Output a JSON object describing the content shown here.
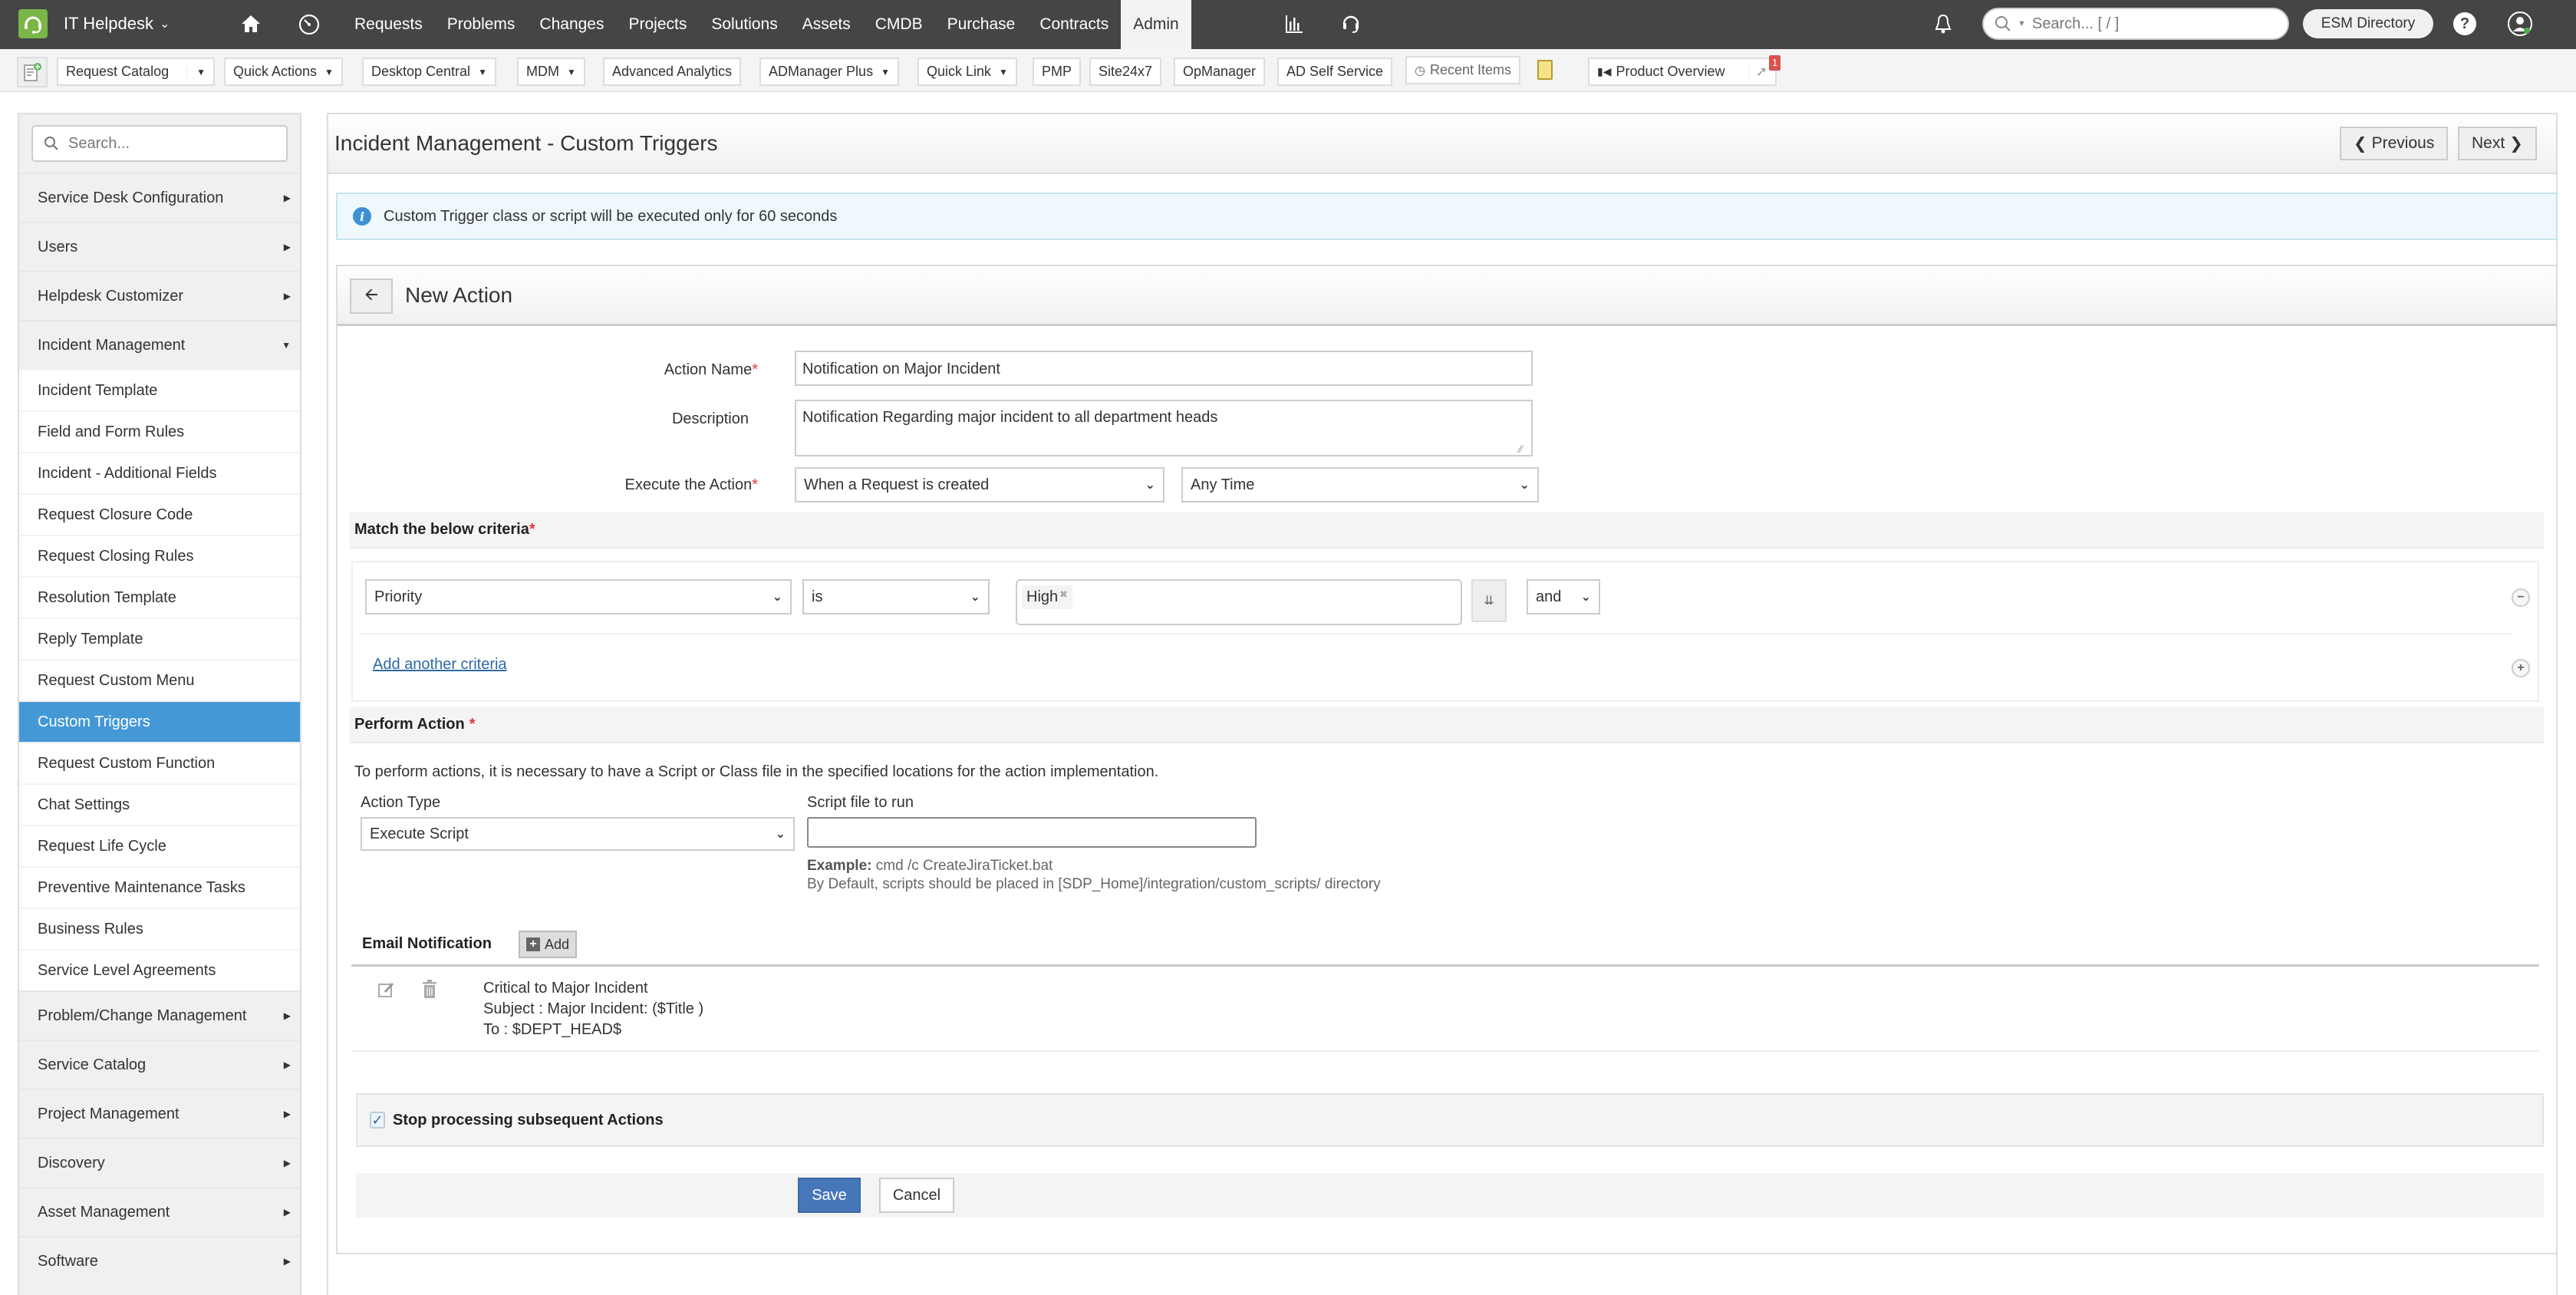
{
  "topnav": {
    "app_name": "IT Helpdesk",
    "links": [
      "Requests",
      "Problems",
      "Changes",
      "Projects",
      "Solutions",
      "Assets",
      "CMDB",
      "Purchase",
      "Contracts",
      "Admin"
    ],
    "active_link": "Admin",
    "search_placeholder": "Search... [ / ]",
    "esm_directory_label": "ESM Directory",
    "help_label": "?"
  },
  "toolbar": {
    "request_catalog": "Request Catalog",
    "quick_actions": "Quick Actions",
    "desktop_central": "Desktop Central",
    "mdm": "MDM",
    "advanced_analytics": "Advanced Analytics",
    "admanager_plus": "ADManager Plus",
    "quick_link": "Quick Link",
    "pmp": "PMP",
    "site24x7": "Site24x7",
    "opmanager": "OpManager",
    "ad_self_service": "AD Self Service",
    "recent_items": "Recent Items",
    "product_overview": "Product Overview",
    "notification_count": "1"
  },
  "sidebar": {
    "search_placeholder": "Search...",
    "groups_top": [
      {
        "label": "Service Desk Configuration"
      },
      {
        "label": "Users"
      },
      {
        "label": "Helpdesk Customizer"
      }
    ],
    "open_group": "Incident Management",
    "sub_items": [
      "Incident Template",
      "Field and Form Rules",
      "Incident - Additional Fields",
      "Request Closure Code",
      "Request Closing Rules",
      "Resolution Template",
      "Reply Template",
      "Request Custom Menu",
      "Custom Triggers",
      "Request Custom Function",
      "Chat Settings",
      "Request Life Cycle",
      "Preventive Maintenance Tasks",
      "Business Rules",
      "Service Level Agreements"
    ],
    "active_sub": "Custom Triggers",
    "groups_bottom": [
      {
        "label": "Problem/Change Management"
      },
      {
        "label": "Service Catalog"
      },
      {
        "label": "Project Management"
      },
      {
        "label": "Discovery"
      },
      {
        "label": "Asset Management"
      },
      {
        "label": "Software"
      }
    ]
  },
  "page": {
    "title": "Incident Management - Custom Triggers",
    "previous_label": "Previous",
    "next_label": "Next",
    "info_message": "Custom Trigger class or script will be executed only for 60 seconds"
  },
  "action": {
    "heading": "New Action",
    "action_name_label": "Action Name",
    "action_name_value": "Notification on Major Incident",
    "description_label": "Description",
    "description_value": "Notification Regarding major incident to all department heads",
    "execute_label": "Execute the Action",
    "execute_when": "When a Request is created",
    "execute_time": "Any Time",
    "criteria_heading": "Match the below criteria",
    "criteria": {
      "field": "Priority",
      "operator": "is",
      "values": [
        "High"
      ],
      "conjunction": "and"
    },
    "add_criteria_label": "Add another criteria",
    "perform_heading": "Perform Action",
    "perform_note": "To perform actions, it is necessary to have a Script or Class file in the specified locations for the action implementation.",
    "action_type_label": "Action Type",
    "action_type_value": "Execute Script",
    "script_label": "Script file to run",
    "script_value": "",
    "example_label": "Example:",
    "example_value": "cmd /c CreateJiraTicket.bat",
    "default_path_note": "By Default, scripts should be placed in [SDP_Home]/integration/custom_scripts/ directory",
    "email_notification_label": "Email Notification",
    "email_add_label": "Add",
    "email_notifications": [
      {
        "name": "Critical to Major Incident",
        "subject": "Subject : Major Incident: ($Title )",
        "to": "To : $DEPT_HEAD$"
      }
    ],
    "stop_processing_label": "Stop processing subsequent Actions",
    "stop_processing_checked": true,
    "save_label": "Save",
    "cancel_label": "Cancel"
  },
  "colors": {
    "topnav_bg": "#454545",
    "logo_green": "#7ab648",
    "sidebar_active": "#4498d6",
    "save_button": "#4677b9",
    "info_bg": "#eff8fc",
    "required": "#e03a3a",
    "badge": "#d9534f"
  }
}
